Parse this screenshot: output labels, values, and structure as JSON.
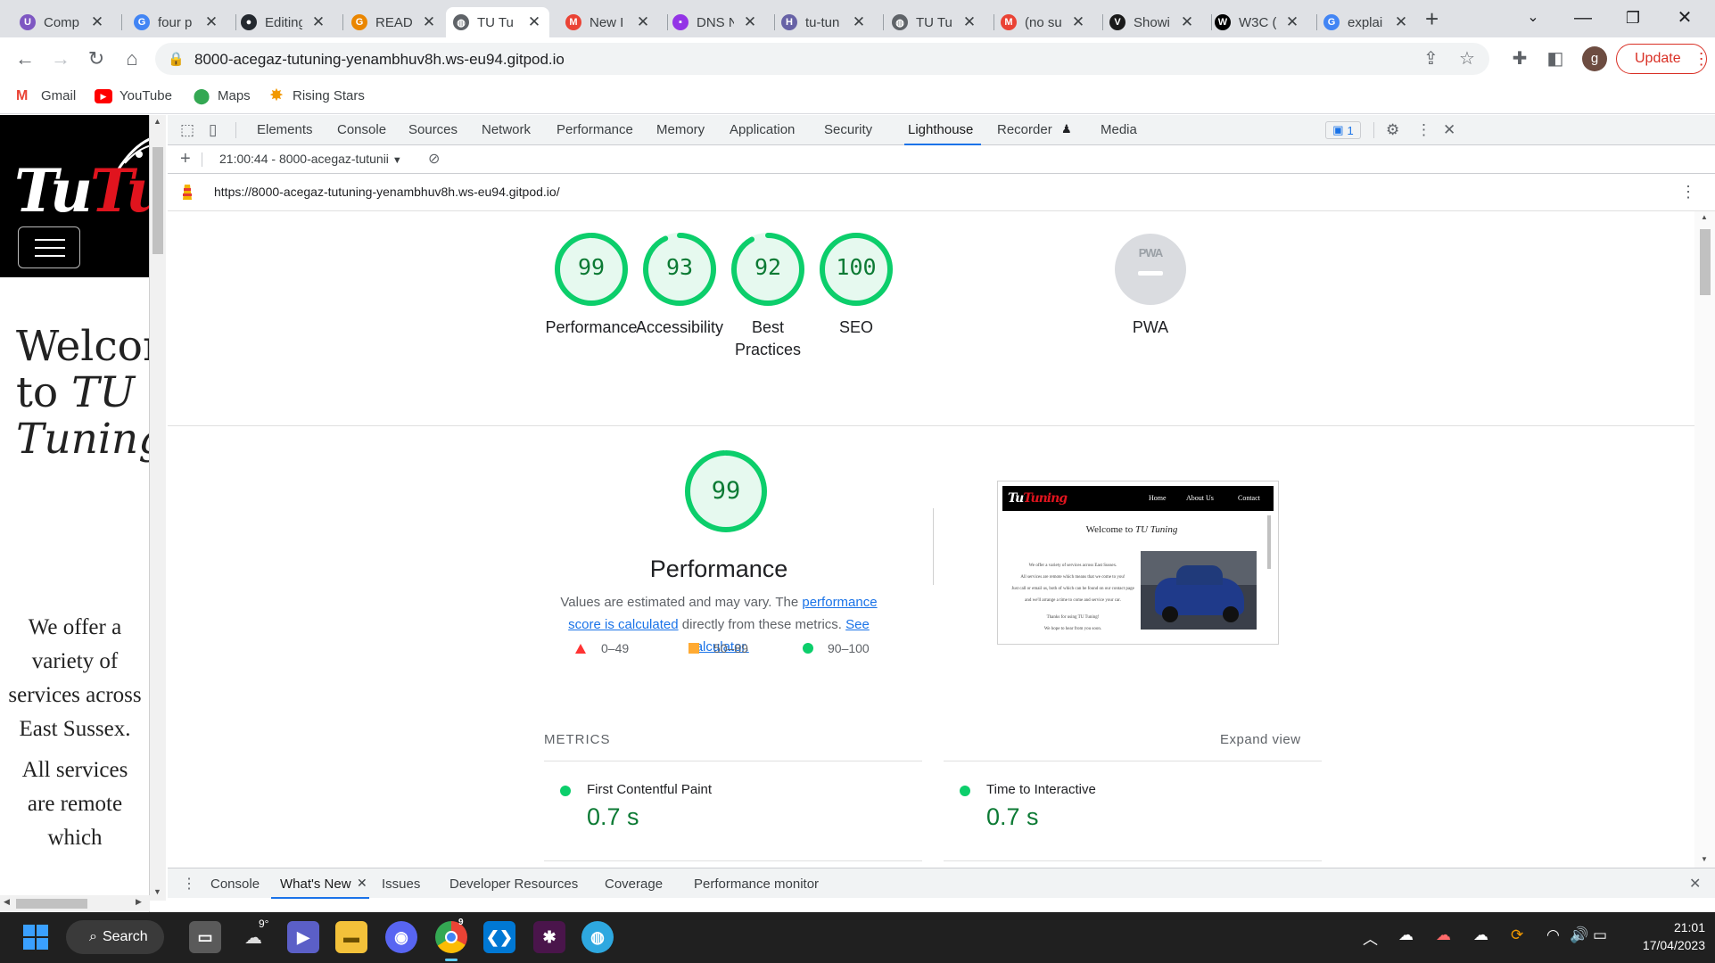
{
  "browser": {
    "tabs": [
      {
        "label": "Comp",
        "favicon": "purple-circle-icon",
        "color": "#7e57c2",
        "glyph": "U"
      },
      {
        "label": "four p",
        "favicon": "google-icon",
        "color": "#4285f4",
        "glyph": "G"
      },
      {
        "label": "Editing",
        "favicon": "github-icon",
        "color": "#24292f",
        "glyph": "●"
      },
      {
        "label": "READ",
        "favicon": "google-icon",
        "color": "#ea8600",
        "glyph": "G"
      },
      {
        "label": "TU Tu",
        "favicon": "globe-icon",
        "color": "#5f6368",
        "glyph": "◍",
        "active": true
      },
      {
        "label": "New I",
        "favicon": "gmail-icon",
        "color": "#ea4335",
        "glyph": "M"
      },
      {
        "label": "DNS N",
        "favicon": "dns-icon",
        "color": "#9334e6",
        "glyph": "▪"
      },
      {
        "label": "tu-tun",
        "favicon": "heroku-icon",
        "color": "#6762a6",
        "glyph": "H"
      },
      {
        "label": "TU Tu",
        "favicon": "globe-icon",
        "color": "#5f6368",
        "glyph": "◍"
      },
      {
        "label": "(no su",
        "favicon": "gmail-icon",
        "color": "#ea4335",
        "glyph": "M"
      },
      {
        "label": "Showi",
        "favicon": "w3c-icon",
        "color": "#1a1a1a",
        "glyph": "V"
      },
      {
        "label": "W3C (",
        "favicon": "w3c-icon",
        "color": "#000000",
        "glyph": "W"
      },
      {
        "label": "explai",
        "favicon": "google-icon",
        "color": "#4285f4",
        "glyph": "G"
      }
    ],
    "url": "8000-acegaz-tutuning-yenambhuv8h.ws-eu94.gitpod.io",
    "profile_initial": "g",
    "update_label": "Update",
    "bookmarks": [
      {
        "label": "Gmail",
        "icon": "gmail-icon"
      },
      {
        "label": "YouTube",
        "icon": "youtube-icon"
      },
      {
        "label": "Maps",
        "icon": "maps-icon"
      },
      {
        "label": "Rising Stars",
        "icon": "star-icon"
      }
    ]
  },
  "site": {
    "logo_white": "Tu",
    "logo_red": "Tuning",
    "title_line1": "Welcome",
    "title_line2_prefix": "to ",
    "title_line2_em": "TU",
    "title_line3_em": "Tuning",
    "para1": "We offer a variety of services across East Sussex.",
    "para2": "All services are remote which"
  },
  "devtools": {
    "tabs": [
      "Elements",
      "Console",
      "Sources",
      "Network",
      "Performance",
      "Memory",
      "Application",
      "Security",
      "Lighthouse",
      "Recorder",
      "Media"
    ],
    "active_tab": "Lighthouse",
    "issues_count": "1",
    "report_selector": "21:00:44 - 8000-acegaz-tutunii",
    "report_url": "https://8000-acegaz-tutuning-yenambhuv8h.ws-eu94.gitpod.io/",
    "drawer_tabs": [
      "Console",
      "What's New",
      "Issues",
      "Developer Resources",
      "Coverage",
      "Performance monitor"
    ],
    "drawer_active": "What's New"
  },
  "lighthouse": {
    "gauges": [
      {
        "label": "Performance",
        "score": 99
      },
      {
        "label": "Accessibility",
        "score": 93
      },
      {
        "label": "Best Practices",
        "score": 92
      },
      {
        "label": "SEO",
        "score": 100
      }
    ],
    "pwa": {
      "label": "PWA",
      "badge": "PWA"
    },
    "pass_color": "#0cce6b",
    "performance": {
      "score": 99,
      "title": "Performance",
      "desc_prefix": "Values are estimated and may vary. The ",
      "desc_link1": "performance score is calculated",
      "desc_middle": " directly from these metrics. ",
      "desc_link2": "See calculator."
    },
    "legend": [
      {
        "range": "0–49",
        "shape": "triangle",
        "color": "#ff3333"
      },
      {
        "range": "50–89",
        "shape": "square",
        "color": "#ffaa33"
      },
      {
        "range": "90–100",
        "shape": "circle",
        "color": "#0cce6b"
      }
    ],
    "metrics_title": "METRICS",
    "expand_label": "Expand view",
    "metrics": [
      {
        "name": "First Contentful Paint",
        "value": "0.7 s"
      },
      {
        "name": "Time to Interactive",
        "value": "0.7 s"
      }
    ],
    "screenshot": {
      "nav": [
        "Home",
        "About Us",
        "Contact"
      ],
      "heading": "Welcome to ",
      "heading_em": "TU Tuning",
      "lines": [
        "We offer a variety of services across East Sussex.",
        "All services are remote which means that we come to you!",
        "Just call or email us, both of which can be found on our contact page",
        "and we'll arrange a time to come and service your car.",
        "Thanks for using TU Tuning!",
        "We hope to hear from you soon."
      ]
    }
  },
  "taskbar": {
    "search_label": "Search",
    "weather": "9°",
    "chrome_badge": "9",
    "time": "21:01",
    "date": "17/04/2023"
  }
}
